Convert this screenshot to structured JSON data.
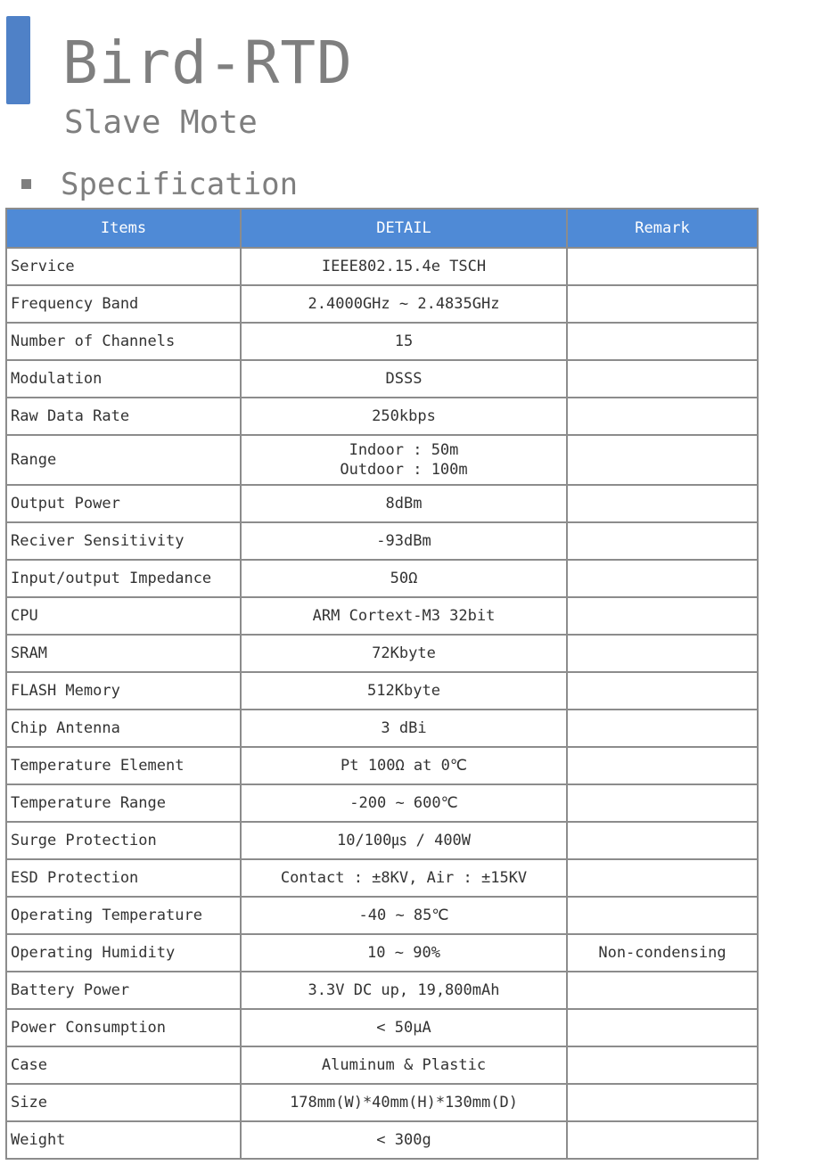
{
  "header": {
    "title": "Bird-RTD",
    "subtitle": "Slave Mote"
  },
  "section": {
    "title": "Specification"
  },
  "table": {
    "columns": [
      "Items",
      "DETAIL",
      "Remark"
    ],
    "rows": [
      {
        "item": "Service",
        "detail": "IEEE802.15.4e TSCH",
        "remark": ""
      },
      {
        "item": "Frequency Band",
        "detail": "2.4000GHz ~ 2.4835GHz",
        "remark": ""
      },
      {
        "item": "Number of Channels",
        "detail": "15",
        "remark": ""
      },
      {
        "item": "Modulation",
        "detail": "DSSS",
        "remark": ""
      },
      {
        "item": "Raw Data Rate",
        "detail": "250kbps",
        "remark": ""
      },
      {
        "item": "Range",
        "detail": "Indoor : 50m",
        "detail2": "Outdoor : 100m",
        "remark": ""
      },
      {
        "item": "Output Power",
        "detail": "8dBm",
        "remark": ""
      },
      {
        "item": "Reciver Sensitivity",
        "detail": "-93dBm",
        "remark": ""
      },
      {
        "item": "Input/output Impedance",
        "detail": "50Ω",
        "remark": ""
      },
      {
        "item": "CPU",
        "detail": "ARM Cortext-M3 32bit",
        "remark": ""
      },
      {
        "item": "SRAM",
        "detail": "72Kbyte",
        "remark": ""
      },
      {
        "item": "FLASH Memory",
        "detail": "512Kbyte",
        "remark": ""
      },
      {
        "item": "Chip Antenna",
        "detail": "3 dBi",
        "remark": ""
      },
      {
        "item": "Temperature Element",
        "detail": "Pt 100Ω at 0℃",
        "remark": ""
      },
      {
        "item": "Temperature Range",
        "detail": "-200 ~ 600℃",
        "remark": ""
      },
      {
        "item": "Surge Protection",
        "detail": "10/100㎲ / 400W",
        "remark": ""
      },
      {
        "item": "ESD Protection",
        "detail": "Contact : ±8KV, Air : ±15KV",
        "remark": ""
      },
      {
        "item": "Operating Temperature",
        "detail": "-40 ~ 85℃",
        "remark": ""
      },
      {
        "item": "Operating Humidity",
        "detail": "10 ~ 90%",
        "remark": "Non-condensing"
      },
      {
        "item": "Battery Power",
        "detail": "3.3V DC up, 19,800mAh",
        "remark": ""
      },
      {
        "item": "Power Consumption",
        "detail": "< 50μA",
        "remark": ""
      },
      {
        "item": "Case",
        "detail": "Aluminum & Plastic",
        "remark": ""
      },
      {
        "item": "Size",
        "detail": "178mm(W)*40mm(H)*130mm(D)",
        "remark": ""
      },
      {
        "item": "Weight",
        "detail": "< 300g",
        "remark": ""
      }
    ]
  },
  "colors": {
    "accent": "#4f81c7",
    "header_bg": "#4f8ad6",
    "title_text": "#7f7f7f",
    "border": "#8c8c8c"
  }
}
